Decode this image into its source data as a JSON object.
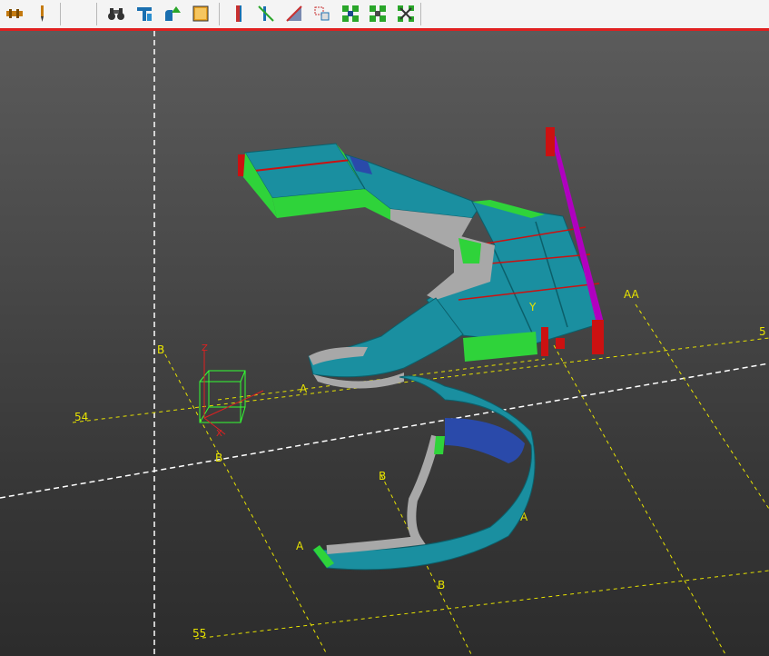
{
  "toolbar": {
    "icons": [
      "beam-icon",
      "pen-icon",
      "binoculars-icon",
      "t-section-icon",
      "shape-up-icon",
      "box-icon",
      "column-icon",
      "line-cut-icon",
      "plane-icon",
      "select-window-icon",
      "cluster-a-icon",
      "cluster-b-icon",
      "cluster-c-icon"
    ]
  },
  "colors": {
    "accent_line": "#e02020",
    "grid": "#e7e300",
    "stair_teal": "#1a8fa0",
    "stair_green": "#2fd33a",
    "rail_magenta": "#b000c0",
    "post_red": "#cc1111",
    "stringer_gray": "#a8a8a8"
  },
  "labels": {
    "grid_aa": "AA",
    "grid_5": "5",
    "grid_a_mid": "A",
    "grid_54": "54",
    "grid_b_mid": "B",
    "grid_b_left": "B",
    "grid_b_lower": "B",
    "grid_a_right": "A",
    "grid_a_lower": "A",
    "grid_b_bottom": "B",
    "grid_55": "55",
    "axis_y_label": "Y",
    "axis_x_label": "X",
    "axis_z_label": "Z"
  }
}
